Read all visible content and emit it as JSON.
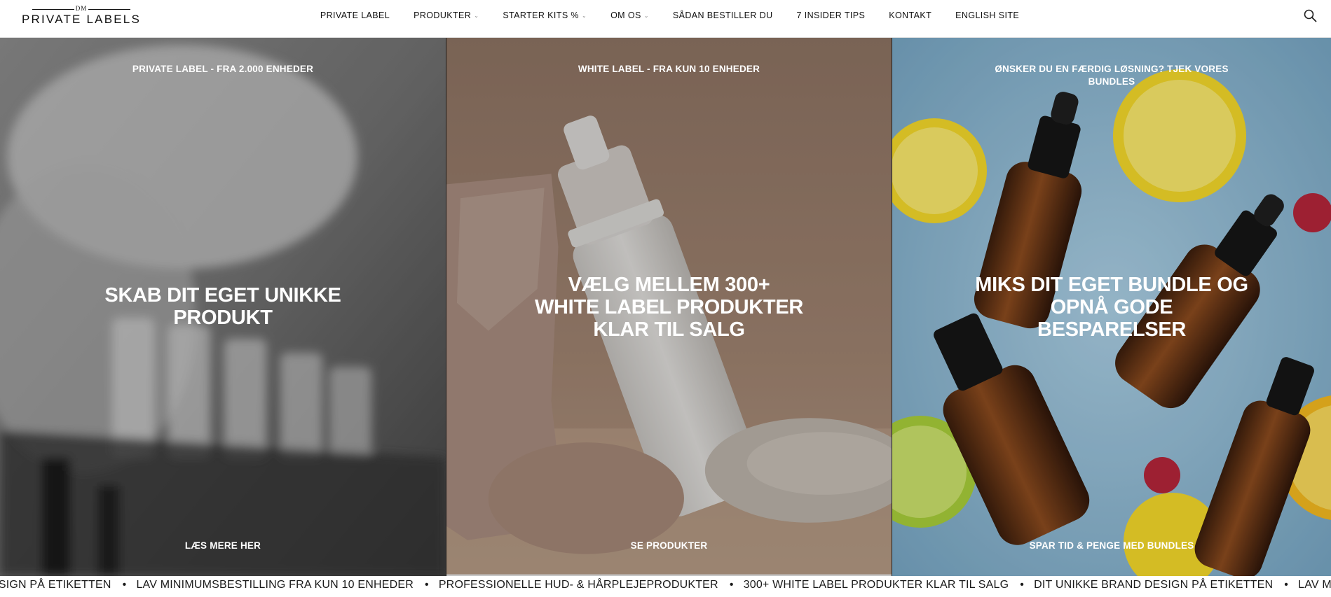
{
  "header": {
    "logo_small": "DM",
    "logo_big": "PRIVATE LABELS",
    "nav": [
      {
        "label": "PRIVATE LABEL",
        "dropdown": false
      },
      {
        "label": "PRODUKTER",
        "dropdown": true
      },
      {
        "label": "STARTER KITS %",
        "dropdown": true
      },
      {
        "label": "OM OS",
        "dropdown": true
      },
      {
        "label": "SÅDAN BESTILLER DU",
        "dropdown": false
      },
      {
        "label": "7 INSIDER TIPS",
        "dropdown": false
      },
      {
        "label": "KONTAKT",
        "dropdown": false
      },
      {
        "label": "ENGLISH SITE",
        "dropdown": false
      }
    ],
    "search_icon": "search-icon"
  },
  "panels": [
    {
      "kicker": "PRIVATE LABEL - FRA 2.000 ENHEDER",
      "headline": [
        "SKAB DIT EGET UNIKKE",
        "PRODUKT"
      ],
      "cta": "LÆS MERE HER"
    },
    {
      "kicker": "WHITE LABEL - FRA KUN 10 ENHEDER",
      "headline": [
        "VÆLG MELLEM 300+",
        "WHITE LABEL PRODUKTER",
        "KLAR TIL SALG"
      ],
      "cta": "SE PRODUKTER"
    },
    {
      "kicker_lines": [
        "ØNSKER DU EN FÆRDIG LØSNING? TJEK VORES",
        "BUNDLES"
      ],
      "headline": [
        "MIKS DIT EGET BUNDLE OG",
        "OPNÅ GODE",
        "BESPARELSER"
      ],
      "cta": "SPAR TID & PENGE MED BUNDLES"
    }
  ],
  "marquee": {
    "items": [
      "ESIGN PÅ ETIKETTEN",
      "LAV MINIMUMSBESTILLING FRA KUN 10 ENHEDER",
      "PROFESSIONELLE HUD- & HÅRPLEJEPRODUKTER",
      "300+ WHITE LABEL PRODUKTER KLAR TIL SALG",
      "DIT UNIKKE BRAND DESIGN PÅ ETIKETTEN",
      "LAV MINIMUMSBESTILLING FRA K"
    ],
    "separator": "•"
  },
  "colors": {
    "text_dark": "#111111",
    "overlay_text": "#ffffff",
    "panel1_bg": "#8a8a8a",
    "panel2_bg": "#a88a78",
    "panel3_bg": "#8fb6cf"
  }
}
